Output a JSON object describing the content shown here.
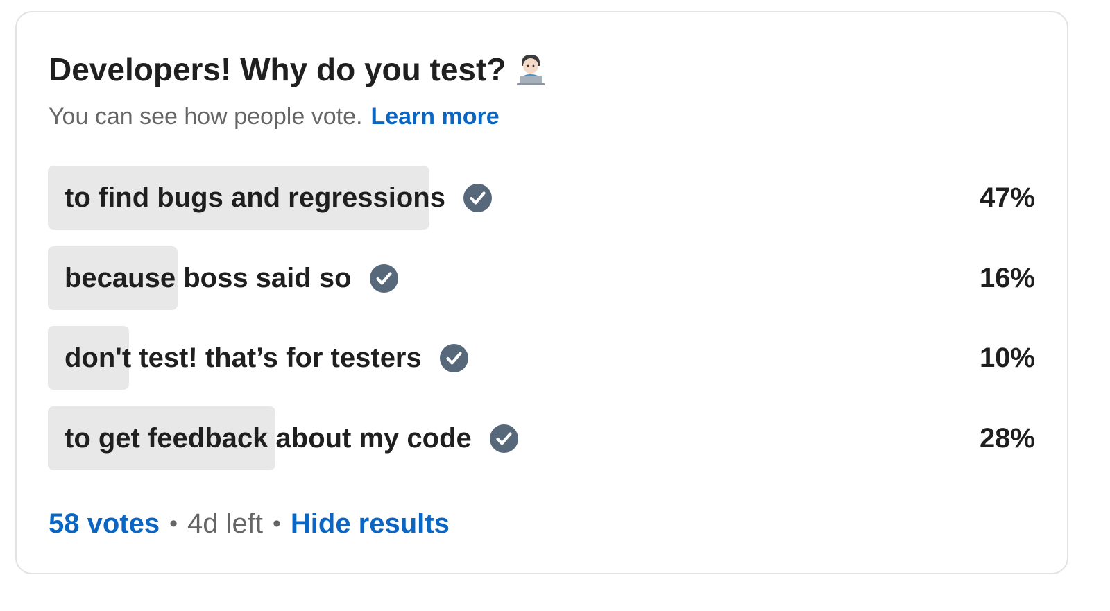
{
  "poll": {
    "title": "Developers! Why do you test?",
    "title_icon": "technologist-emoji-icon",
    "subtitle": "You can see how people vote.",
    "learn_more": "Learn more",
    "options": [
      {
        "label": "to find bugs and regressions",
        "percent_label": "47%",
        "percent": 47,
        "selected_icon": "check-circle-icon"
      },
      {
        "label": "because boss said so",
        "percent_label": "16%",
        "percent": 16,
        "selected_icon": "check-circle-icon"
      },
      {
        "label": "don't test! that’s for testers",
        "percent_label": "10%",
        "percent": 10,
        "selected_icon": "check-circle-icon"
      },
      {
        "label": "to get feedback about my code",
        "percent_label": "28%",
        "percent": 28,
        "selected_icon": "check-circle-icon"
      }
    ],
    "votes": "58 votes",
    "separator": "•",
    "time_left": "4d left",
    "hide_results": "Hide results"
  },
  "colors": {
    "link": "#0a66c2",
    "bar_fill": "#e8e8e8",
    "check_icon": "#56687a",
    "text": "#1f1f1f",
    "muted": "#666666"
  }
}
